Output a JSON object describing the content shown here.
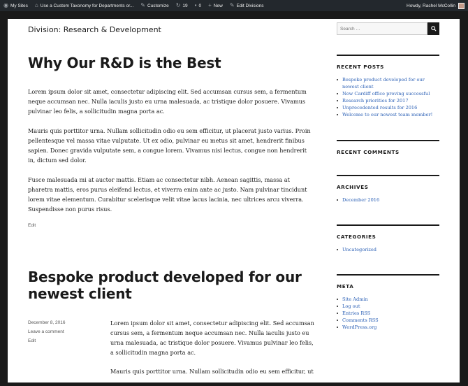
{
  "adminbar": {
    "items": [
      {
        "icon": "wordpress-icon",
        "label": "My Sites"
      },
      {
        "icon": "home-icon",
        "label": "Use a Custom Taxonomy for Departments or..."
      },
      {
        "icon": "brush-icon",
        "label": "Customize"
      },
      {
        "icon": "update-icon",
        "label": "19"
      },
      {
        "icon": "comment-icon",
        "label": "0"
      },
      {
        "icon": "plus-icon",
        "label": "New"
      },
      {
        "icon": "pencil-icon",
        "label": "Edit Divisions"
      }
    ],
    "howdy": "Howdy, Rachel McCollin"
  },
  "page": {
    "division_title": "Division: Research & Development",
    "post1": {
      "title": "Why Our R&D is the Best",
      "paragraphs": [
        "Lorem ipsum dolor sit amet, consectetur adipiscing elit. Sed accumsan cursus sem, a fermentum neque accumsan nec. Nulla iaculis justo eu urna malesuada, ac tristique dolor posuere. Vivamus pulvinar leo felis, a sollicitudin magna porta ac.",
        "Mauris quis porttitor urna. Nullam sollicitudin odio eu sem efficitur, ut placerat justo varius. Proin pellentesque vel massa vitae vulputate. Ut ex odio, pulvinar eu metus sit amet, hendrerit finibus sapien. Donec gravida vulputate sem, a congue lorem. Vivamus nisi lectus, congue non hendrerit in, dictum sed dolor.",
        "Fusce malesuada mi at auctor mattis. Etiam ac consectetur nibh. Aenean sagittis, massa at pharetra mattis, eros purus eleifend lectus, et viverra enim ante ac justo. Nam pulvinar tincidunt lorem vitae elementum. Curabitur scelerisque velit vitae lacus lacinia, nec ultrices arcu viverra. Suspendisse non purus risus."
      ],
      "edit": "Edit"
    },
    "post2": {
      "title": "Bespoke product developed for our newest client",
      "date": "December 8, 2016",
      "leave_comment": "Leave a comment",
      "edit": "Edit",
      "paragraphs": [
        "Lorem ipsum dolor sit amet, consectetur adipiscing elit. Sed accumsan cursus sem, a fermentum neque accumsan nec. Nulla iaculis justo eu urna malesuada, ac tristique dolor posuere. Vivamus pulvinar leo felis, a sollicitudin magna porta ac.",
        "Mauris quis porttitor urna. Nullam sollicitudin odio eu sem efficitur, ut"
      ]
    }
  },
  "sidebar": {
    "search_placeholder": "Search …",
    "recent_posts": {
      "title": "RECENT POSTS",
      "items": [
        "Bespoke product developed for our newest client",
        "New Cardiff office proving successful",
        "Research priorities for 2017",
        "Unprecedented results for 2016",
        "Welcome to our newest team member!"
      ]
    },
    "recent_comments": {
      "title": "RECENT COMMENTS"
    },
    "archives": {
      "title": "ARCHIVES",
      "items": [
        "December 2016"
      ]
    },
    "categories": {
      "title": "CATEGORIES",
      "items": [
        "Uncategorized"
      ]
    },
    "meta": {
      "title": "META",
      "items": [
        "Site Admin",
        "Log out",
        "Entries RSS",
        "Comments RSS",
        "WordPress.org"
      ]
    }
  }
}
